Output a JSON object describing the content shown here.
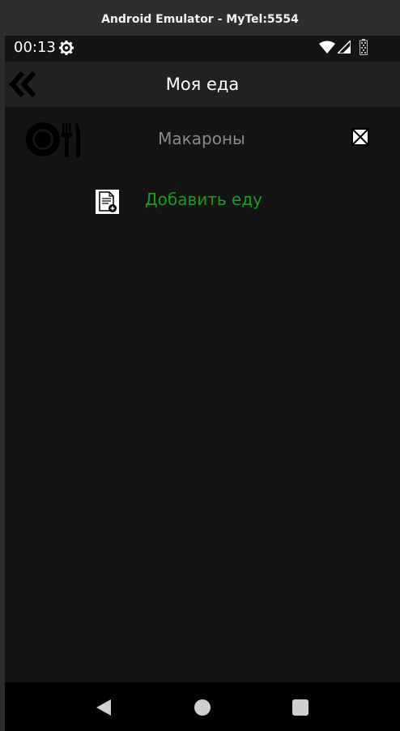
{
  "window": {
    "title": "Android Emulator - MyTel:5554"
  },
  "statusbar": {
    "time": "00:13",
    "icons": [
      "settings-gear-icon",
      "wifi-icon",
      "cell-signal-icon",
      "battery-icon"
    ]
  },
  "appbar": {
    "back_icon": "double-chevron-left-icon",
    "title": "Моя еда"
  },
  "food_list": [
    {
      "icon": "plate-cutlery-icon",
      "name": "Макароны",
      "delete_icon": "close-box-icon"
    }
  ],
  "add_food": {
    "icon": "add-document-icon",
    "label": "Добавить еду"
  },
  "navbar": {
    "icons": [
      "back-triangle-icon",
      "home-circle-icon",
      "recents-square-icon"
    ]
  },
  "colors": {
    "background": "#141414",
    "appbar": "#212121",
    "add_label": "#1c9a1c",
    "food_name": "#8a8a8a"
  }
}
